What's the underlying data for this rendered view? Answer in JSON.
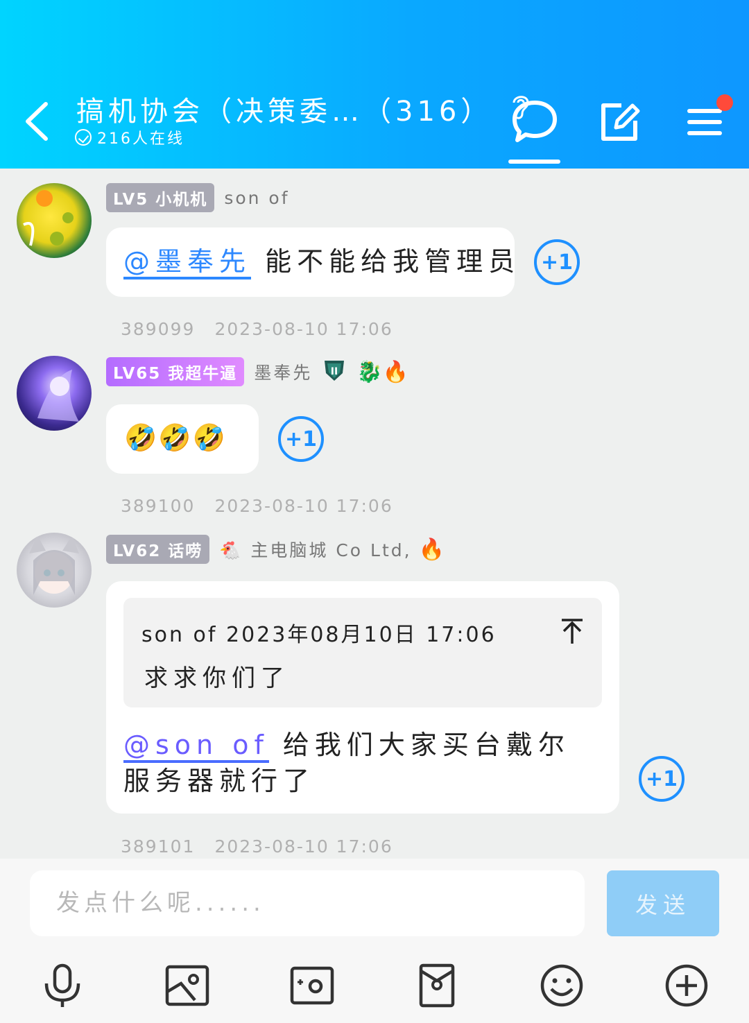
{
  "header": {
    "title": "搞机协会（决策委…（316）",
    "online": "216人在线"
  },
  "messages": [
    {
      "level": "LV5 小机机",
      "nick": "son of",
      "text_mention": "@墨奉先",
      "text": " 能不能给我管理员",
      "id": "389099",
      "time": "2023-08-10 17:06",
      "plus": "+1"
    },
    {
      "level": "LV65 我超牛逼",
      "nick": "墨奉先",
      "badges": [
        "🐉",
        "🔥"
      ],
      "text": "🤣🤣🤣",
      "id": "389100",
      "time": "2023-08-10 17:06",
      "plus": "+1"
    },
    {
      "level": "LV62 话唠",
      "nick": "🐔 主电脑城 Co Ltd,",
      "badges": [
        "🔥"
      ],
      "quote_head": "son of 2023年08月10日  17:06",
      "quote_body": "求求你们了",
      "text_mention": "@son of",
      "text": " 给我们大家买台戴尔服务器就行了",
      "id": "389101",
      "time": "2023-08-10 17:06",
      "plus": "+1"
    }
  ],
  "composer": {
    "placeholder": "发点什么呢......",
    "send": "发送"
  },
  "icons": [
    "back-icon",
    "chat-icon",
    "edit-icon",
    "menu-icon",
    "mic-icon",
    "image-icon",
    "camera-icon",
    "envelope-icon",
    "smiley-icon",
    "plus-circle-icon"
  ],
  "colors": {
    "header_start": "#00d4ff",
    "header_end": "#0e97ff",
    "accent": "#1e90ff",
    "send_bg": "#8fcdf7"
  }
}
